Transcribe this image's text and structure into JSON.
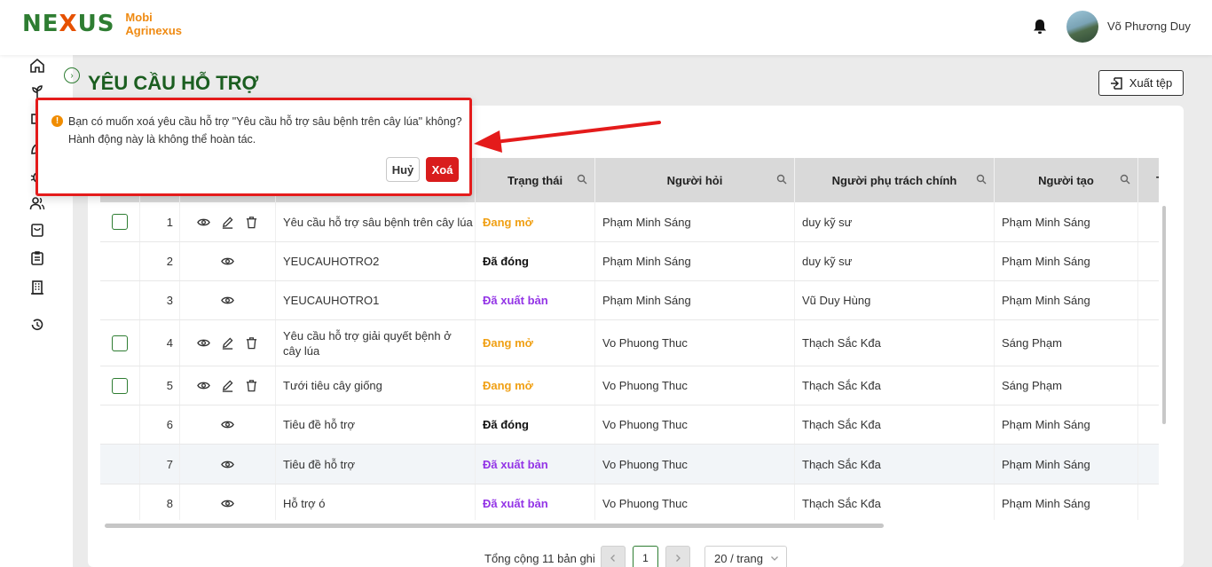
{
  "brand": {
    "mark": "NEXUS",
    "line1": "Mobi",
    "line2": "Agrinexus"
  },
  "user": {
    "name": "Võ Phương Duy"
  },
  "page": {
    "title": "YÊU CẦU HỖ TRỢ",
    "export_label": "Xuất tệp"
  },
  "popconfirm": {
    "message_line1": "Bạn có muốn xoá yêu cầu hỗ trợ \"Yêu cầu hỗ trợ sâu bệnh trên cây lúa\" không?",
    "message_line2": "Hành động này là không thể hoàn tác.",
    "cancel_label": "Huỷ",
    "confirm_label": "Xoá"
  },
  "table": {
    "headers": {
      "status": "Trạng thái",
      "asker": "Người hỏi",
      "owner": "Người phụ trách chính",
      "creator": "Người tạo",
      "more": "Th"
    },
    "rows": [
      {
        "no": "1",
        "title": "Yêu cầu hỗ trợ sâu bệnh trên cây lúa",
        "status": "Đang mở",
        "asker": "Phạm Minh Sáng",
        "owner": "duy kỹ sư",
        "creator": "Phạm Minh Sáng"
      },
      {
        "no": "2",
        "title": "YEUCAUHOTRO2",
        "status": "Đã đóng",
        "asker": "Phạm Minh Sáng",
        "owner": "duy kỹ sư",
        "creator": "Phạm Minh Sáng"
      },
      {
        "no": "3",
        "title": "YEUCAUHOTRO1",
        "status": "Đã xuất bản",
        "asker": "Phạm Minh Sáng",
        "owner": "Vũ Duy Hùng",
        "creator": "Phạm Minh Sáng"
      },
      {
        "no": "4",
        "title": "Yêu cầu hỗ trợ giải quyết bệnh ở cây lúa",
        "status": "Đang mở",
        "asker": "Vo Phuong Thuc",
        "owner": "Thạch Sắc Kđa",
        "creator": "Sáng Phạm"
      },
      {
        "no": "5",
        "title": "Tưới tiêu cây giống",
        "status": "Đang mở",
        "asker": "Vo Phuong Thuc",
        "owner": "Thạch Sắc Kđa",
        "creator": "Sáng Phạm"
      },
      {
        "no": "6",
        "title": "Tiêu đề hỗ trợ",
        "status": "Đã đóng",
        "asker": "Vo Phuong Thuc",
        "owner": "Thạch Sắc Kđa",
        "creator": "Phạm Minh Sáng"
      },
      {
        "no": "7",
        "title": "Tiêu đề hỗ trợ",
        "status": "Đã xuất bản",
        "asker": "Vo Phuong Thuc",
        "owner": "Thạch Sắc Kđa",
        "creator": "Phạm Minh Sáng"
      },
      {
        "no": "8",
        "title": "Hỗ trợ ó",
        "status": "Đã xuất bản",
        "asker": "Vo Phuong Thuc",
        "owner": "Thạch Sắc Kđa",
        "creator": "Phạm Minh Sáng"
      }
    ]
  },
  "pagination": {
    "total": "Tổng cộng 11 bản ghi",
    "current": "1",
    "page_size": "20 / trang"
  },
  "icons": {
    "bell": "bell-icon",
    "export": "export-icon",
    "search": "search-icon",
    "view": "eye-icon",
    "edit": "pencil-icon",
    "delete": "trash-icon"
  },
  "colors": {
    "brand_green": "#1b5e20",
    "status_open": "#f0a015",
    "status_published": "#9334e6",
    "danger": "#d91c1c"
  }
}
